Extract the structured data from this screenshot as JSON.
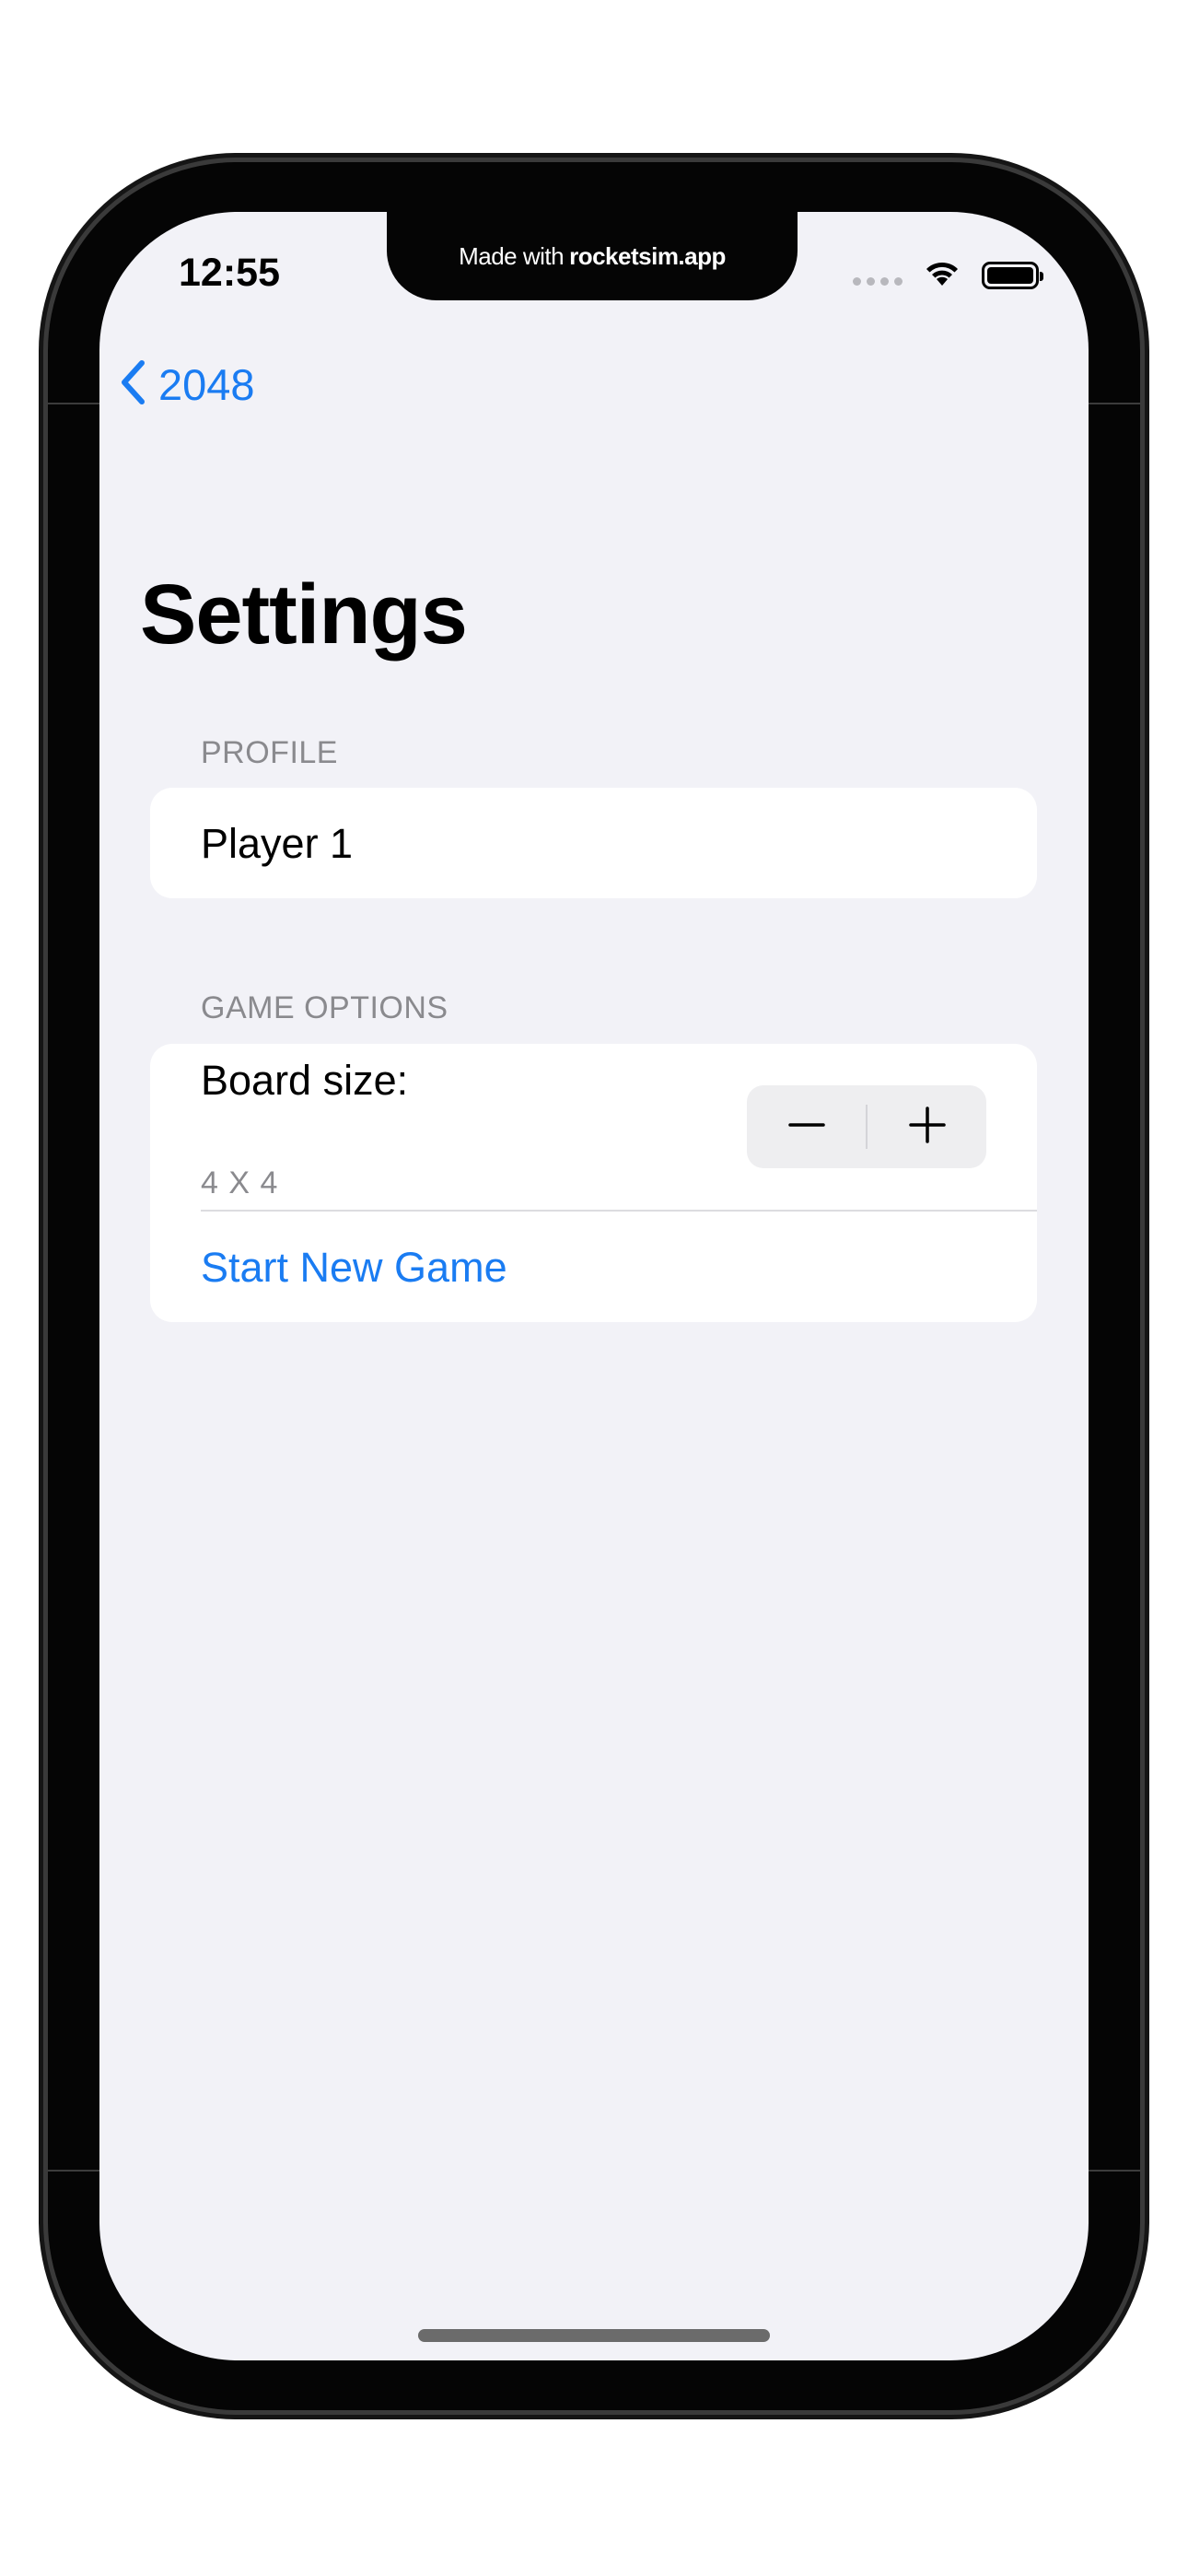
{
  "overlay": {
    "prefix": "Made with",
    "brand": "rocketsim.app"
  },
  "status_bar": {
    "time": "12:55",
    "signal_icon": "cellular-dots-icon",
    "wifi_icon": "wifi-icon",
    "battery_icon": "battery-full-icon"
  },
  "nav": {
    "back_label": "2048",
    "back_icon": "chevron-left-icon"
  },
  "page": {
    "title": "Settings"
  },
  "profile_section": {
    "header": "PROFILE",
    "player_name": "Player 1"
  },
  "game_section": {
    "header": "GAME OPTIONS",
    "board_size_label": "Board size:",
    "board_size_value": "4 X 4",
    "stepper_decrement_icon": "minus-icon",
    "stepper_increment_icon": "plus-icon",
    "start_button": "Start New Game"
  },
  "colors": {
    "accent": "#1a7cf2",
    "background": "#f2f2f7",
    "card": "#ffffff",
    "secondary_text": "#8a8a8e"
  }
}
